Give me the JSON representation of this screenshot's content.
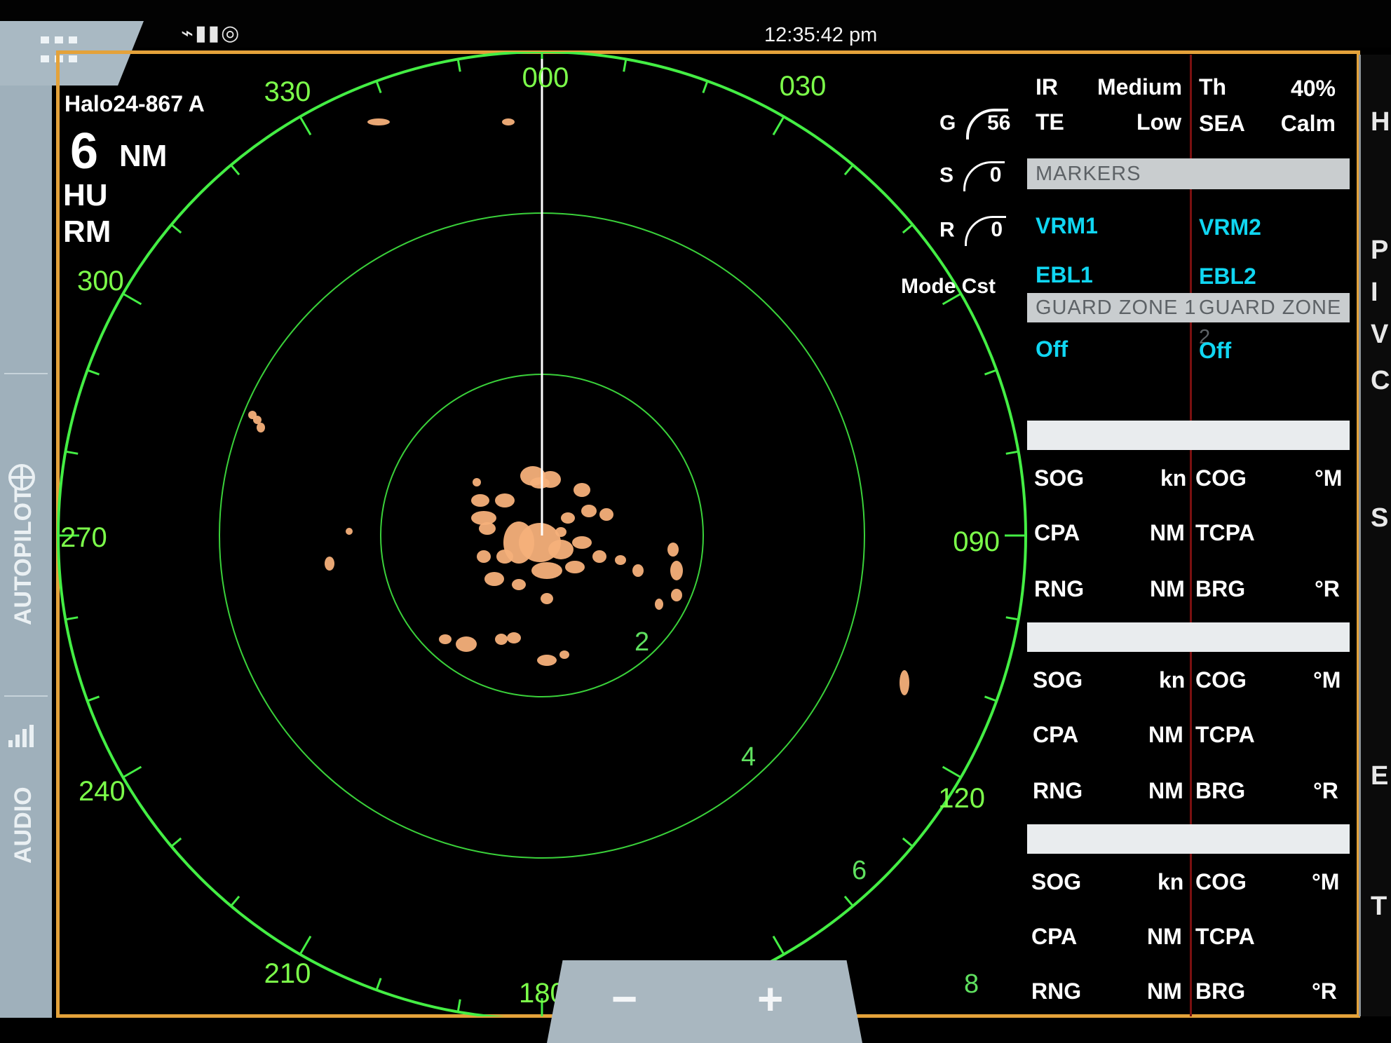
{
  "status_bar": {
    "time": "12:35:42 pm",
    "icons": [
      "antenna-icon",
      "signal-bars-icon",
      "wifi-icon"
    ],
    "menu_icon": "apps-grid-icon"
  },
  "sidebar": {
    "items": [
      {
        "label": "AUTOPILOT",
        "icon": "steering-wheel-icon"
      },
      {
        "label": "AUDIO",
        "icon": "audio-bars-icon"
      }
    ]
  },
  "radar": {
    "name": "Halo24-867 A",
    "range_value": "6",
    "range_unit": "NM",
    "orientation": "HU",
    "motion": "RM",
    "bearing_labels": [
      "000",
      "030",
      "090",
      "120",
      "180",
      "210",
      "240",
      "270",
      "300",
      "330"
    ],
    "ring_labels": [
      "2",
      "4",
      "6",
      "8"
    ],
    "controls": {
      "gain_label": "G",
      "gain_value": "56",
      "sea_label": "S",
      "sea_value": "0",
      "rain_label": "R",
      "rain_value": "0",
      "mode_label": "Mode",
      "mode_value": "Cst"
    },
    "colors": {
      "rings": "#3ad13a",
      "outer_ring": "#44ee44",
      "echo": "#f5b07a",
      "heading_line": "#ffffff"
    }
  },
  "panel": {
    "settings": [
      {
        "key": "IR",
        "value": "Medium"
      },
      {
        "key": "Th",
        "value": "40%"
      },
      {
        "key": "TE",
        "value": "Low"
      },
      {
        "key": "SEA",
        "value": "Calm"
      }
    ],
    "markers_header": "MARKERS",
    "markers": [
      "VRM1",
      "VRM2",
      "EBL1",
      "EBL2"
    ],
    "guard_zone_1": "GUARD ZONE 1",
    "guard_zone_2": "GUARD ZONE 2",
    "guard_zone_1_state": "Off",
    "guard_zone_2_state": "Off",
    "target_blocks": [
      {
        "rows": [
          {
            "l": "SOG",
            "lu": "kn",
            "r": "COG",
            "ru": "°M"
          },
          {
            "l": "CPA",
            "lu": "NM",
            "r": "TCPA",
            "ru": ""
          },
          {
            "l": "RNG",
            "lu": "NM",
            "r": "BRG",
            "ru": "°R"
          }
        ]
      },
      {
        "rows": [
          {
            "l": "SOG",
            "lu": "kn",
            "r": "COG",
            "ru": "°M"
          },
          {
            "l": "CPA",
            "lu": "NM",
            "r": "TCPA",
            "ru": ""
          },
          {
            "l": "RNG",
            "lu": "NM",
            "r": "BRG",
            "ru": "°R"
          }
        ]
      },
      {
        "rows": [
          {
            "l": "SOG",
            "lu": "kn",
            "r": "COG",
            "ru": "°M"
          },
          {
            "l": "CPA",
            "lu": "NM",
            "r": "TCPA",
            "ru": ""
          },
          {
            "l": "RNG",
            "lu": "NM",
            "r": "BRG",
            "ru": "°R"
          }
        ]
      }
    ]
  },
  "far_right": {
    "clipped_labels": [
      "H",
      "P",
      "I",
      "V",
      "C",
      "S",
      "E",
      "T"
    ]
  },
  "zoom": {
    "minus": "−",
    "plus": "+"
  }
}
